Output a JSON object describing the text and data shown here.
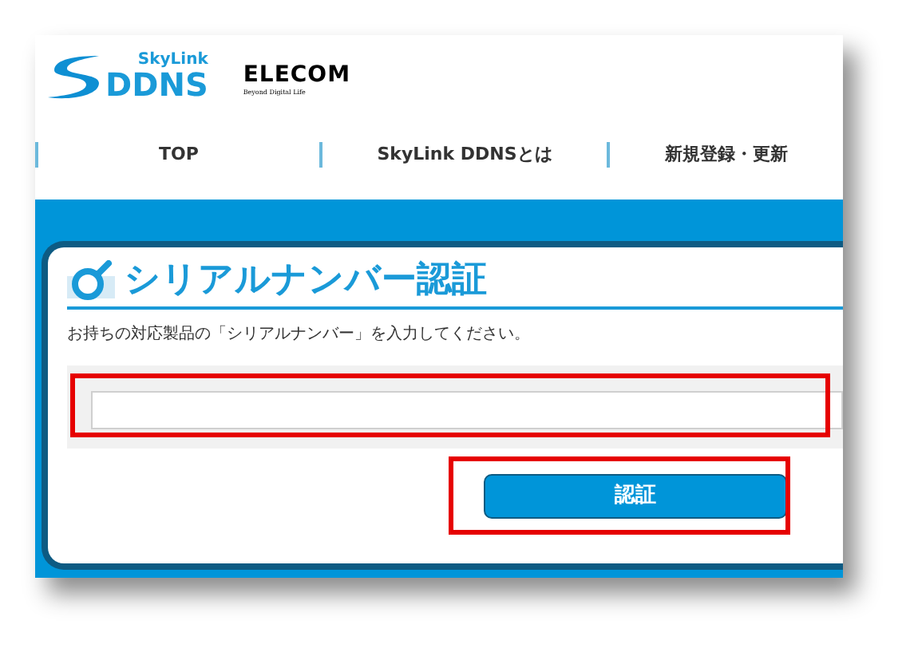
{
  "header": {
    "logo_top": "SkyLink",
    "logo_main": "DDNS",
    "brand": "ELECOM",
    "tagline": "Beyond Digital Life"
  },
  "nav": [
    {
      "label": "TOP"
    },
    {
      "label": "SkyLink DDNSとは"
    },
    {
      "label": "新規登録・更新"
    }
  ],
  "card": {
    "title": "シリアルナンバー認証",
    "description": "お持ちの対応製品の「シリアルナンバー」を入力してください。",
    "submit_button": "認証"
  }
}
